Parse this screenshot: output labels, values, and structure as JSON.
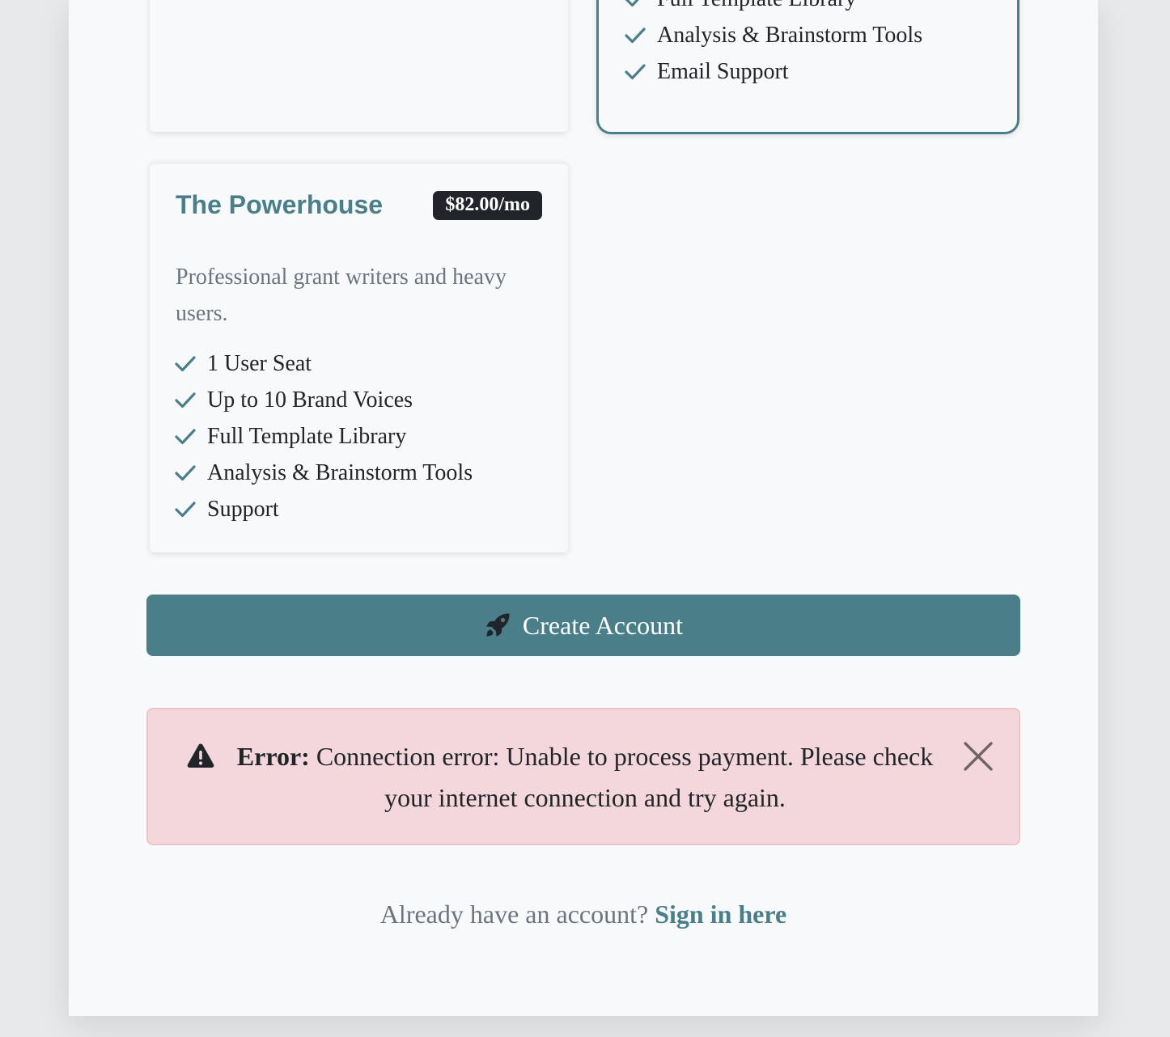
{
  "plans": {
    "previous_plan": {
      "features": [
        "Full Template Library",
        "Analysis & Brainstorm Tools",
        "Email Support"
      ]
    },
    "powerhouse": {
      "title": "The Powerhouse",
      "price": "$82.00/mo",
      "description": "Professional grant writers and heavy users.",
      "features": [
        "1 User Seat",
        "Up to 10 Brand Voices",
        "Full Template Library",
        "Analysis & Brainstorm Tools",
        "Support"
      ]
    }
  },
  "actions": {
    "create_account_label": "Create Account",
    "create_account_icon": "rocket-icon"
  },
  "alert": {
    "label": "Error:",
    "message": "Connection error: Unable to process payment. Please check your internet connection and try again.",
    "icon": "warning-triangle-icon",
    "close_icon": "close-icon"
  },
  "footer": {
    "prompt": "Already have an account?",
    "link_label": "Sign in here"
  },
  "colors": {
    "accent": "#4a7f8a",
    "error_background": "#f3d7dc",
    "badge_background": "#212529"
  }
}
